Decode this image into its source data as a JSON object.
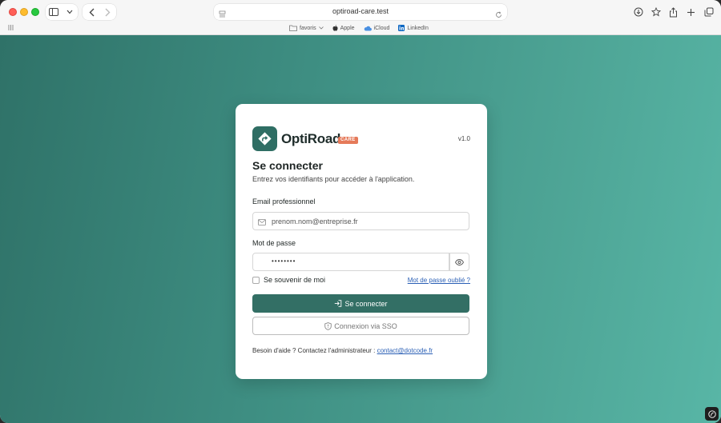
{
  "browser": {
    "url": "optiroad-care.test",
    "favorites": [
      {
        "label": "favoris",
        "icon": "folder-icon"
      },
      {
        "label": "Apple",
        "icon": "apple-icon"
      },
      {
        "label": "iCloud",
        "icon": "cloud-icon"
      },
      {
        "label": "LinkedIn",
        "icon": "linkedin-icon"
      }
    ]
  },
  "login": {
    "brand": "OptiRoad",
    "badge": "CARE",
    "version": "v1.0",
    "title": "Se connecter",
    "subtitle": "Entrez vos identifiants pour accéder à l'application.",
    "email_label": "Email professionnel",
    "email_placeholder": "prenom.nom@entreprise.fr",
    "password_label": "Mot de passe",
    "password_value": "••••••••",
    "remember_label": "Se souvenir de moi",
    "forgot_link": "Mot de passe oublié ?",
    "submit_label": "Se connecter",
    "sso_label": "Connexion via SSO",
    "help_text": "Besoin d'aide ? Contactez l'administrateur : ",
    "help_email": "contact@dotcode.fr"
  },
  "colors": {
    "brand": "#2f6e64",
    "primary_button": "#336f65",
    "badge": "#e57a5a",
    "link": "#2a5fb5"
  }
}
